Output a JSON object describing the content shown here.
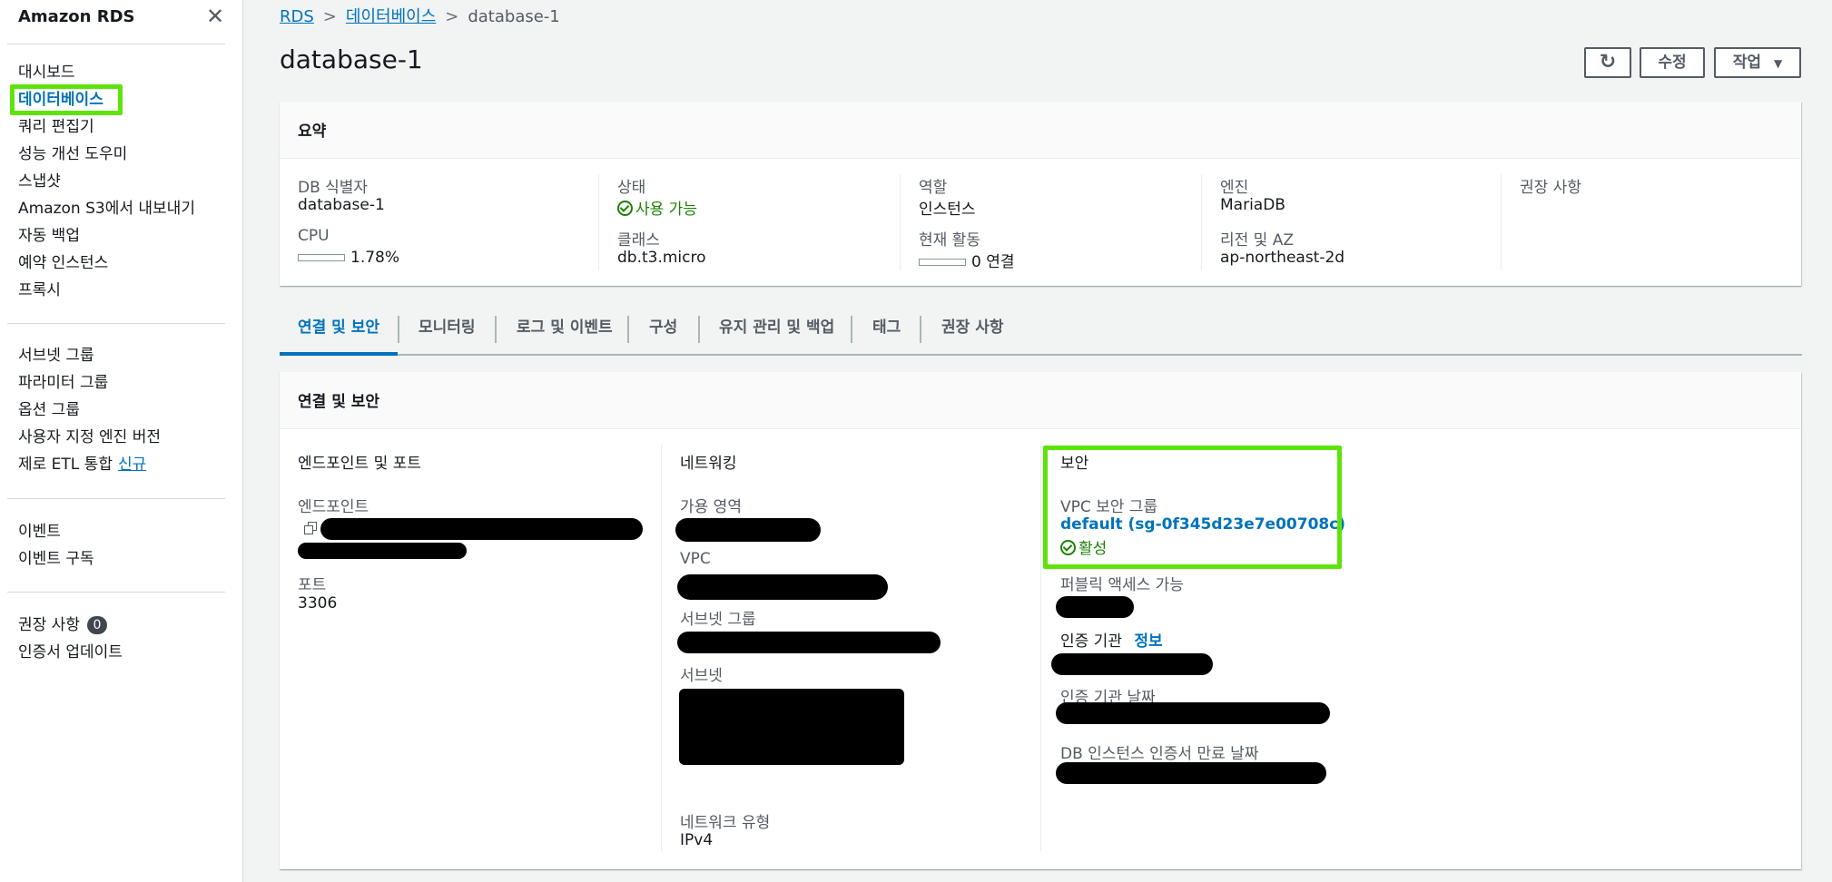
{
  "sidebar": {
    "title": "Amazon RDS",
    "close_icon": "✕",
    "group1": [
      "대시보드",
      "데이터베이스",
      "쿼리 편집기",
      "성능 개선 도우미",
      "스냅샷",
      "Amazon S3에서 내보내기",
      "자동 백업",
      "예약 인스턴스",
      "프록시"
    ],
    "group2": [
      "서브넷 그룹",
      "파라미터 그룹",
      "옵션 그룹",
      "사용자 지정 엔진 버전",
      "제로 ETL 통합"
    ],
    "new_badge": "신규",
    "group3": [
      "이벤트",
      "이벤트 구독"
    ],
    "group4": [
      "권장 사항",
      "인증서 업데이트"
    ],
    "recommendations_count": "0"
  },
  "breadcrumb": {
    "rds": "RDS",
    "databases": "데이터베이스",
    "current": "database-1",
    "separator": ">"
  },
  "page_title": "database-1",
  "actions": {
    "refresh_icon": "↻",
    "modify": "수정",
    "actions": "작업",
    "actions_caret": "▼"
  },
  "summary": {
    "title": "요약",
    "db_id_label": "DB 식별자",
    "db_id_value": "database-1",
    "cpu_label": "CPU",
    "cpu_value": "1.78%",
    "cpu_fraction": 0.0178,
    "status_label": "상태",
    "status_value": "사용 가능",
    "class_label": "클래스",
    "class_value": "db.t3.micro",
    "role_label": "역할",
    "role_value": "인스턴스",
    "activity_label": "현재 활동",
    "activity_value": "0 연결",
    "engine_label": "엔진",
    "engine_value": "MariaDB",
    "region_label": "리전 및 AZ",
    "region_value": "ap-northeast-2d",
    "recommendations_label": "권장 사항"
  },
  "tabs": [
    "연결 및 보안",
    "모니터링",
    "로그 및 이벤트",
    "구성",
    "유지 관리 및 백업",
    "태그",
    "권장 사항"
  ],
  "connectivity": {
    "title": "연결 및 보안",
    "endpoint_section": "엔드포인트 및 포트",
    "endpoint_label": "엔드포인트",
    "port_label": "포트",
    "port_value": "3306",
    "network_section": "네트워킹",
    "az_label": "가용 영역",
    "vpc_label": "VPC",
    "subnet_group_label": "서브넷 그룹",
    "subnets_label": "서브넷",
    "network_type_label": "네트워크 유형",
    "network_type_value": "IPv4",
    "security_section": "보안",
    "vpc_sg_label": "VPC 보안 그룹",
    "vpc_sg_value": "default (sg-0f345d23e7e00708c)",
    "vpc_sg_status": "활성",
    "public_access_label": "퍼블릭 액세스 가능",
    "ca_label": "인증 기관",
    "ca_info": "정보",
    "ca_date_label": "인증 기관 날짜",
    "cert_expiry_label": "DB 인스턴스 인증서 만료 날짜"
  },
  "colors": {
    "accent": "#0073bb",
    "success": "#1d8102",
    "highlight": "#5ee30a"
  }
}
